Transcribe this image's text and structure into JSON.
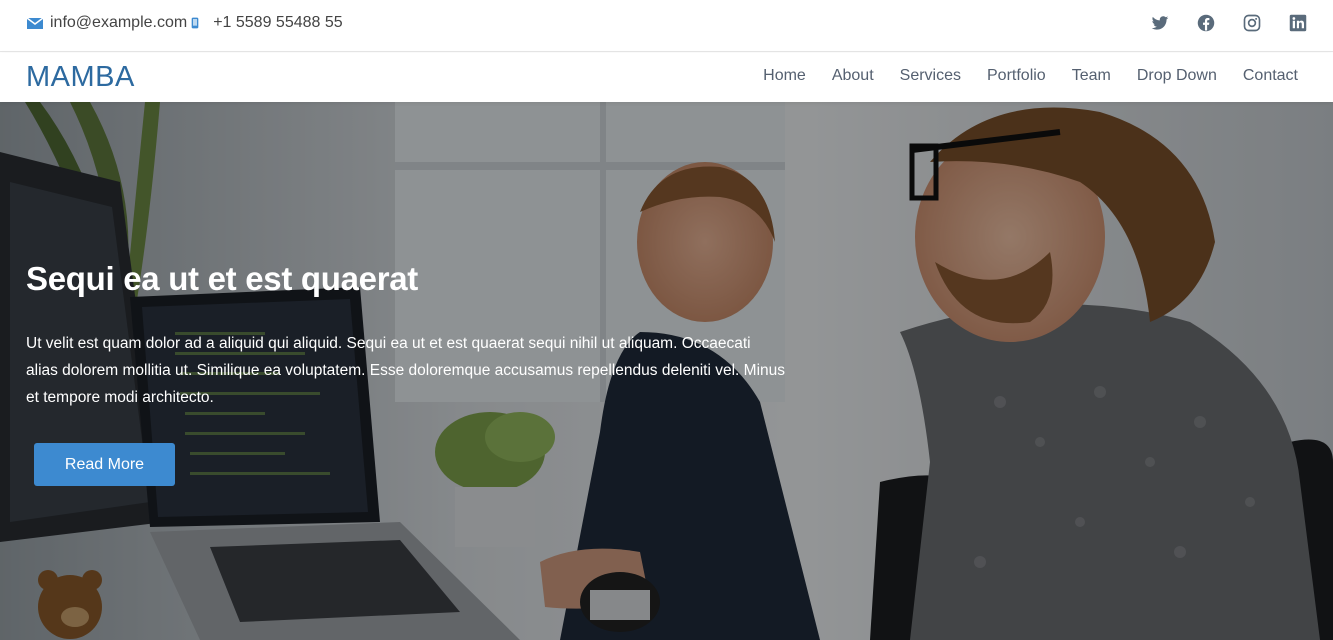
{
  "topbar": {
    "email": "info@example.com",
    "phone": "+1 5589 55488 55",
    "email_icon": "envelope-icon",
    "phone_icon": "phone-icon",
    "social": [
      "twitter-icon",
      "facebook-icon",
      "instagram-icon",
      "linkedin-icon"
    ]
  },
  "header": {
    "logo": "MAMBA",
    "nav": [
      "Home",
      "About",
      "Services",
      "Portfolio",
      "Team",
      "Drop Down",
      "Contact"
    ]
  },
  "hero": {
    "title": "Sequi ea ut et est quaerat",
    "text": "Ut velit est quam dolor ad a aliquid qui aliquid. Sequi ea ut et est quaerat sequi nihil ut aliquam. Occaecati alias dolorem mollitia ut. Similique ea voluptatem. Esse doloremque accusamus repellendus deleniti vel. Minus et tempore modi architecto.",
    "button": "Read More"
  },
  "colors": {
    "accent": "#3d8ad0",
    "logo": "#2d6aa0",
    "icon": "#5a6b7b"
  }
}
